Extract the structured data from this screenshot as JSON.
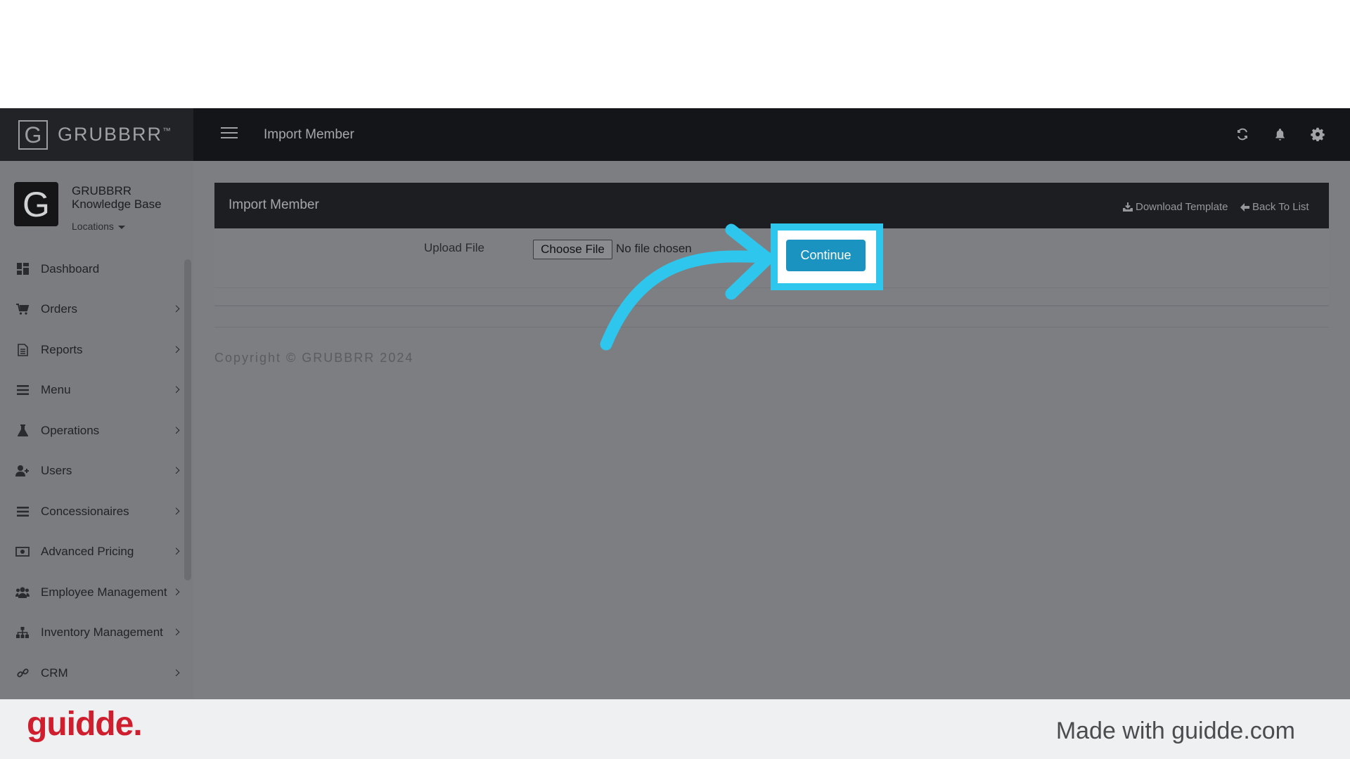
{
  "app": {
    "brand_mark": "G",
    "brand_name": "GRUBBRR",
    "brand_tm": "™",
    "page_title": "Import Member"
  },
  "profile": {
    "avatar_letter": "G",
    "name": "GRUBBRR Knowledge Base",
    "locations_label": "Locations"
  },
  "sidebar": {
    "items": [
      {
        "label": "Dashboard",
        "icon": "dashboard-icon"
      },
      {
        "label": "Orders",
        "icon": "cart-icon"
      },
      {
        "label": "Reports",
        "icon": "report-icon"
      },
      {
        "label": "Menu",
        "icon": "list-icon"
      },
      {
        "label": "Operations",
        "icon": "flask-icon"
      },
      {
        "label": "Users",
        "icon": "user-plus-icon"
      },
      {
        "label": "Concessionaires",
        "icon": "list-icon"
      },
      {
        "label": "Advanced Pricing",
        "icon": "money-icon"
      },
      {
        "label": "Employee Management",
        "icon": "users-icon"
      },
      {
        "label": "Inventory Management",
        "icon": "sitemap-icon"
      },
      {
        "label": "CRM",
        "icon": "link-icon"
      }
    ]
  },
  "panel": {
    "title": "Import Member",
    "download_template": "Download Template",
    "back_to_list": "Back To List",
    "upload_label": "Upload File",
    "choose_file": "Choose File",
    "no_file": "No file chosen",
    "continue": "Continue"
  },
  "footer": {
    "copyright": "Copyright © GRUBBRR 2024"
  },
  "banner": {
    "logo": "guidde.",
    "made_with": "Made with guidde.com"
  },
  "colors": {
    "highlight": "#2ec6ec",
    "primary_button": "#1a93c0",
    "guidde_red": "#cf1f2e"
  }
}
